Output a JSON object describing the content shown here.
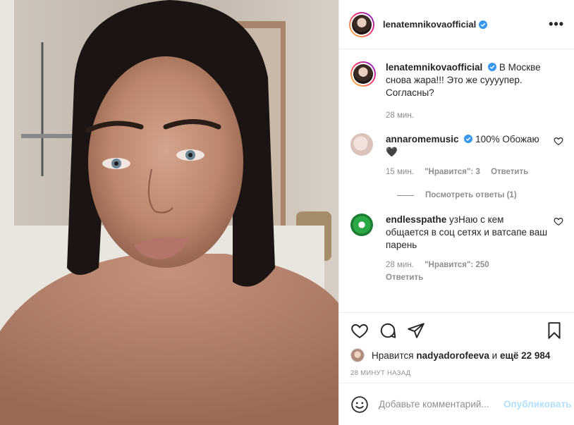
{
  "post": {
    "author": "lenatemnikovaofficial",
    "caption": "В Москве снова жара!!! Это же суууупер. Согласны?",
    "caption_time": "28 мин."
  },
  "header": {
    "username": "lenatemnikovaofficial",
    "more_label": "•••"
  },
  "comments": [
    {
      "username": "annaromemusic",
      "text": "100% Обожаю🖤",
      "time": "15 мин.",
      "likes": "\"Нравится\": 3",
      "reply": "Ответить",
      "view_replies": "Посмотреть ответы (1)"
    },
    {
      "username": "endlesspathe",
      "text": "узНаю с кем общается в соц сетях и ватсапе ваш парень",
      "time": "28 мин.",
      "likes": "\"Нравится\": 250",
      "reply": "Ответить"
    }
  ],
  "likes": {
    "prefix": "Нравится",
    "user": "nadyadorofeeva",
    "middle": "и",
    "rest": "ещё 22 984"
  },
  "time_ago": "28 МИНУТ НАЗАД",
  "add_comment": {
    "placeholder": "Добавьте комментарий...",
    "publish": "Опубликовать"
  },
  "colors": {
    "verified": "#3897f0",
    "link": "#b2dffc",
    "muted": "#8e8e8e"
  },
  "icons": [
    "more-icon",
    "verified-icon",
    "heart-icon",
    "comment-icon",
    "share-icon",
    "bookmark-icon",
    "emoji-icon"
  ]
}
